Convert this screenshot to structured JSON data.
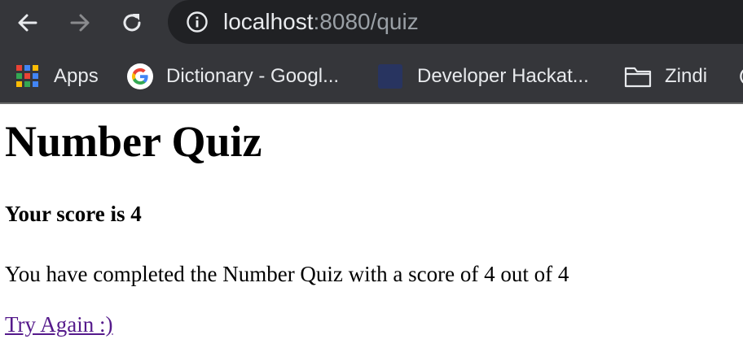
{
  "browser": {
    "url_host": "localhost",
    "url_rest": ":8080/quiz",
    "icons": {
      "back": "arrow-left-icon",
      "forward": "arrow-right-icon",
      "reload": "reload-icon",
      "site_info": "info-icon"
    },
    "colors": {
      "chrome_bg": "#35363a",
      "omnibox_bg": "#202124",
      "text": "#e8eaed",
      "text_dim": "#9aa0a6"
    }
  },
  "bookmarks": {
    "items": [
      {
        "label": "Apps",
        "icon": "apps-grid-icon"
      },
      {
        "label": "Dictionary - Googl...",
        "icon": "google-icon"
      },
      {
        "label": "Developer Hackat...",
        "icon": "developer-icon"
      },
      {
        "label": "Zindi",
        "icon": "folder-icon"
      }
    ]
  },
  "page": {
    "title": "Number Quiz",
    "score_heading": "Your score is 4",
    "completion_text": "You have completed the Number Quiz with a score of 4 out of 4",
    "try_again_label": "Try Again :)",
    "link_color": "#551a8b"
  }
}
